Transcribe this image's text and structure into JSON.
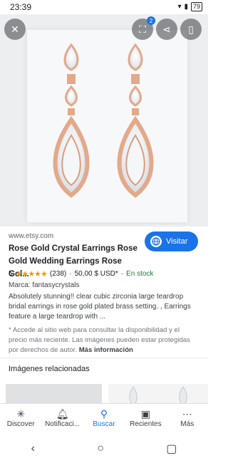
{
  "status_bar": {
    "time": "23:39",
    "battery": "79"
  },
  "hero": {
    "collection_count": "2"
  },
  "result": {
    "source": "www.etsy.com",
    "title": "Rose Gold Crystal Earrings Rose Gold Wedding Earrings Rose Gol...",
    "visit_label": "Visitar",
    "rating": "5",
    "stars": "★★★★★",
    "review_count": "(238)",
    "price": "50,00 $ USD*",
    "stock": "En stock",
    "brand": "Marca: fantasycrystals",
    "description": "Absolutely stunning!! clear cubic zirconia large teardrop bridal earrings in rose gold plated brass setting. , Earrings feature a large teardrop with ...",
    "note": "* Accede al sitio web para consultar la disponibilidad y el precio más reciente. Las imágenes pueden estar protegidas por derechos de autor.",
    "note_more": "Más información"
  },
  "related_title": "Imágenes relacionadas",
  "bottom_nav": [
    {
      "label": "Discover",
      "icon": "asterisk-icon"
    },
    {
      "label": "Notificaci...",
      "icon": "bell-icon"
    },
    {
      "label": "Buscar",
      "icon": "search-icon"
    },
    {
      "label": "Recientes",
      "icon": "recents-icon"
    },
    {
      "label": "Más",
      "icon": "more-icon"
    }
  ],
  "colors": {
    "accent": "#1a73e8",
    "stock": "#188038",
    "star": "#f29900"
  }
}
